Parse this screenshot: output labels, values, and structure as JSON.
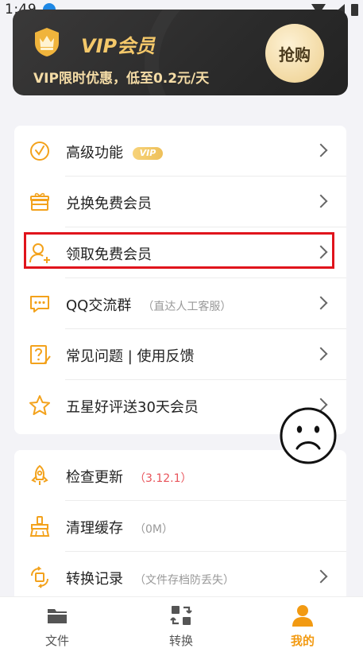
{
  "status_bar": {
    "time": "1:49",
    "icons": [
      "download-icon",
      "wifi-icon",
      "signal-icon",
      "battery-icon"
    ]
  },
  "vip_banner": {
    "title": "VIP会员",
    "subtitle": "VIP限时优惠，低至0.2元/天",
    "buy_label": "抢购",
    "badge_icon": "crown-shield-icon",
    "colors": {
      "title": "#f4c86a",
      "button": "#f2d9a2",
      "background": "#2b2b2b"
    }
  },
  "menu_main": {
    "items": [
      {
        "icon": "clock-check-icon",
        "label": "高级功能",
        "tag": "VIP",
        "note": ""
      },
      {
        "icon": "gift-icon",
        "label": "兑换免费会员",
        "tag": "",
        "note": ""
      },
      {
        "icon": "user-add-icon",
        "label": "领取免费会员",
        "tag": "",
        "note": ""
      },
      {
        "icon": "chat-dots-icon",
        "label": "QQ交流群",
        "tag": "",
        "note": "（直达人工客服）"
      },
      {
        "icon": "question-edit-icon",
        "label": "常见问题 | 使用反馈",
        "tag": "",
        "note": ""
      },
      {
        "icon": "star-icon",
        "label": "五星好评送30天会员",
        "tag": "",
        "note": ""
      }
    ]
  },
  "menu_secondary": {
    "items": [
      {
        "icon": "rocket-icon",
        "label": "检查更新",
        "note": "（3.12.1）"
      },
      {
        "icon": "broom-icon",
        "label": "清理缓存",
        "note": "（0M）"
      },
      {
        "icon": "convert-record-icon",
        "label": "转换记录",
        "note": "（文件存档防丢失）"
      }
    ]
  },
  "bottom_nav": {
    "items": [
      {
        "icon": "folder-icon",
        "label": "文件",
        "active": false
      },
      {
        "icon": "convert-icon",
        "label": "转换",
        "active": false
      },
      {
        "icon": "person-icon",
        "label": "我的",
        "active": true
      }
    ],
    "accent": "#f29a12"
  },
  "accent_colors": {
    "icon_orange": "#f3a21c",
    "highlight_box": "#e0141c",
    "note_red": "#e8545b"
  }
}
